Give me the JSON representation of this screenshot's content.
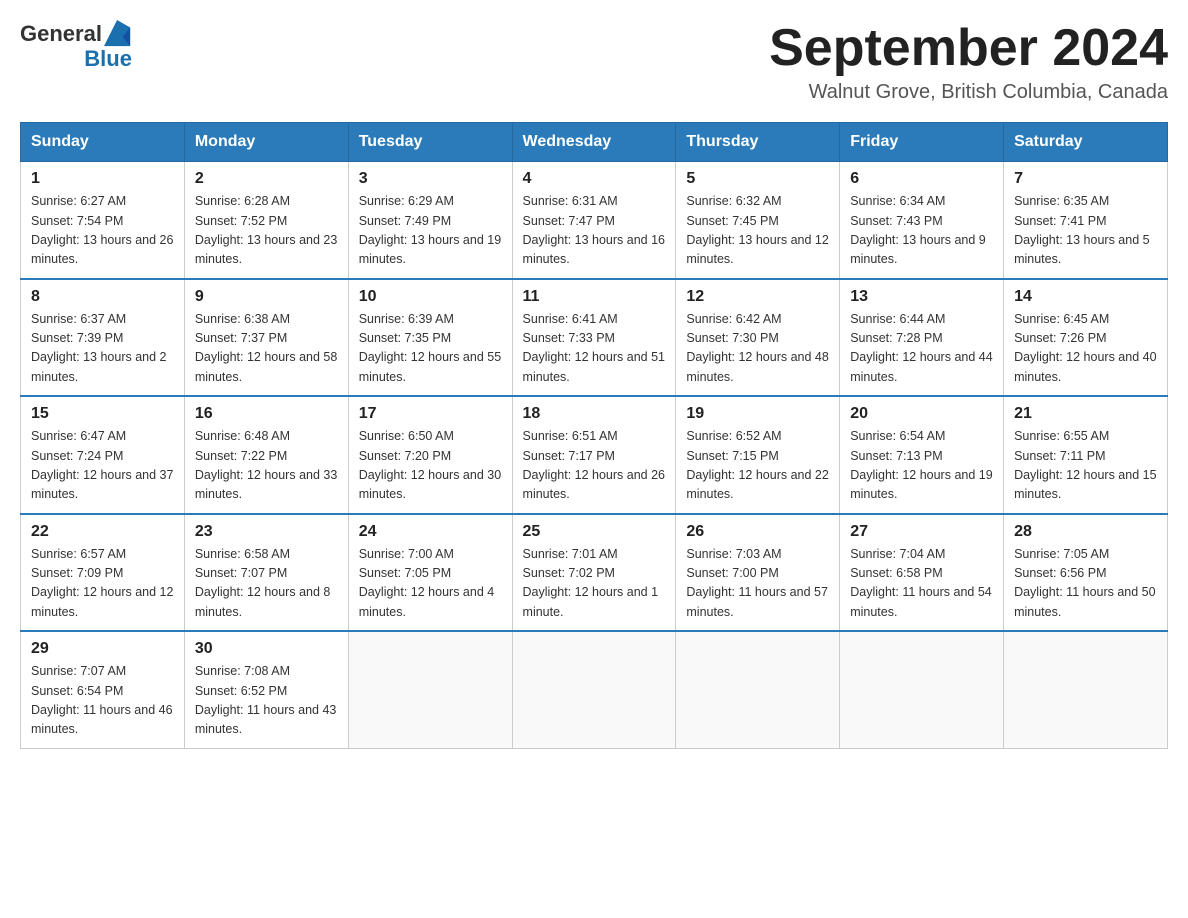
{
  "header": {
    "logo_text_general": "General",
    "logo_text_blue": "Blue",
    "month_title": "September 2024",
    "location": "Walnut Grove, British Columbia, Canada"
  },
  "days_of_week": [
    "Sunday",
    "Monday",
    "Tuesday",
    "Wednesday",
    "Thursday",
    "Friday",
    "Saturday"
  ],
  "weeks": [
    [
      {
        "day": "1",
        "sunrise": "6:27 AM",
        "sunset": "7:54 PM",
        "daylight": "13 hours and 26 minutes."
      },
      {
        "day": "2",
        "sunrise": "6:28 AM",
        "sunset": "7:52 PM",
        "daylight": "13 hours and 23 minutes."
      },
      {
        "day": "3",
        "sunrise": "6:29 AM",
        "sunset": "7:49 PM",
        "daylight": "13 hours and 19 minutes."
      },
      {
        "day": "4",
        "sunrise": "6:31 AM",
        "sunset": "7:47 PM",
        "daylight": "13 hours and 16 minutes."
      },
      {
        "day": "5",
        "sunrise": "6:32 AM",
        "sunset": "7:45 PM",
        "daylight": "13 hours and 12 minutes."
      },
      {
        "day": "6",
        "sunrise": "6:34 AM",
        "sunset": "7:43 PM",
        "daylight": "13 hours and 9 minutes."
      },
      {
        "day": "7",
        "sunrise": "6:35 AM",
        "sunset": "7:41 PM",
        "daylight": "13 hours and 5 minutes."
      }
    ],
    [
      {
        "day": "8",
        "sunrise": "6:37 AM",
        "sunset": "7:39 PM",
        "daylight": "13 hours and 2 minutes."
      },
      {
        "day": "9",
        "sunrise": "6:38 AM",
        "sunset": "7:37 PM",
        "daylight": "12 hours and 58 minutes."
      },
      {
        "day": "10",
        "sunrise": "6:39 AM",
        "sunset": "7:35 PM",
        "daylight": "12 hours and 55 minutes."
      },
      {
        "day": "11",
        "sunrise": "6:41 AM",
        "sunset": "7:33 PM",
        "daylight": "12 hours and 51 minutes."
      },
      {
        "day": "12",
        "sunrise": "6:42 AM",
        "sunset": "7:30 PM",
        "daylight": "12 hours and 48 minutes."
      },
      {
        "day": "13",
        "sunrise": "6:44 AM",
        "sunset": "7:28 PM",
        "daylight": "12 hours and 44 minutes."
      },
      {
        "day": "14",
        "sunrise": "6:45 AM",
        "sunset": "7:26 PM",
        "daylight": "12 hours and 40 minutes."
      }
    ],
    [
      {
        "day": "15",
        "sunrise": "6:47 AM",
        "sunset": "7:24 PM",
        "daylight": "12 hours and 37 minutes."
      },
      {
        "day": "16",
        "sunrise": "6:48 AM",
        "sunset": "7:22 PM",
        "daylight": "12 hours and 33 minutes."
      },
      {
        "day": "17",
        "sunrise": "6:50 AM",
        "sunset": "7:20 PM",
        "daylight": "12 hours and 30 minutes."
      },
      {
        "day": "18",
        "sunrise": "6:51 AM",
        "sunset": "7:17 PM",
        "daylight": "12 hours and 26 minutes."
      },
      {
        "day": "19",
        "sunrise": "6:52 AM",
        "sunset": "7:15 PM",
        "daylight": "12 hours and 22 minutes."
      },
      {
        "day": "20",
        "sunrise": "6:54 AM",
        "sunset": "7:13 PM",
        "daylight": "12 hours and 19 minutes."
      },
      {
        "day": "21",
        "sunrise": "6:55 AM",
        "sunset": "7:11 PM",
        "daylight": "12 hours and 15 minutes."
      }
    ],
    [
      {
        "day": "22",
        "sunrise": "6:57 AM",
        "sunset": "7:09 PM",
        "daylight": "12 hours and 12 minutes."
      },
      {
        "day": "23",
        "sunrise": "6:58 AM",
        "sunset": "7:07 PM",
        "daylight": "12 hours and 8 minutes."
      },
      {
        "day": "24",
        "sunrise": "7:00 AM",
        "sunset": "7:05 PM",
        "daylight": "12 hours and 4 minutes."
      },
      {
        "day": "25",
        "sunrise": "7:01 AM",
        "sunset": "7:02 PM",
        "daylight": "12 hours and 1 minute."
      },
      {
        "day": "26",
        "sunrise": "7:03 AM",
        "sunset": "7:00 PM",
        "daylight": "11 hours and 57 minutes."
      },
      {
        "day": "27",
        "sunrise": "7:04 AM",
        "sunset": "6:58 PM",
        "daylight": "11 hours and 54 minutes."
      },
      {
        "day": "28",
        "sunrise": "7:05 AM",
        "sunset": "6:56 PM",
        "daylight": "11 hours and 50 minutes."
      }
    ],
    [
      {
        "day": "29",
        "sunrise": "7:07 AM",
        "sunset": "6:54 PM",
        "daylight": "11 hours and 46 minutes."
      },
      {
        "day": "30",
        "sunrise": "7:08 AM",
        "sunset": "6:52 PM",
        "daylight": "11 hours and 43 minutes."
      },
      null,
      null,
      null,
      null,
      null
    ]
  ]
}
